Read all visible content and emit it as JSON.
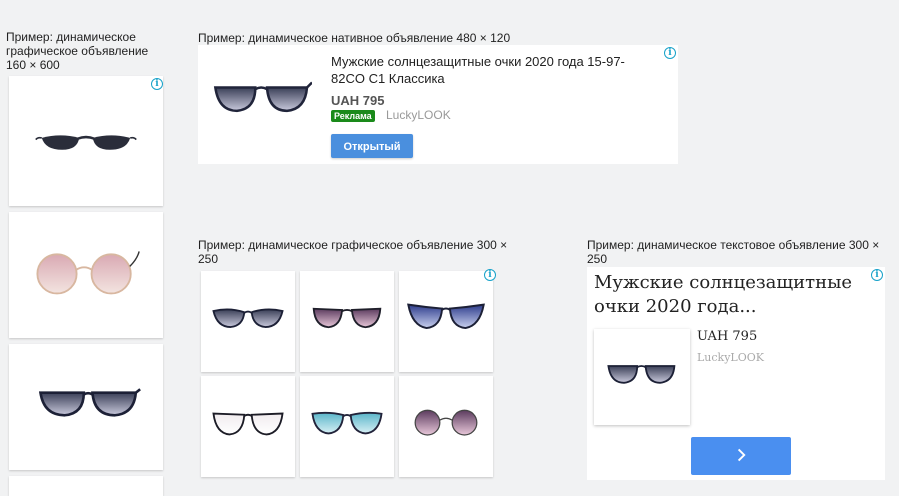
{
  "captions": {
    "vertical": "Пример: динамическое графическое объявление 160 × 600",
    "native": "Пример: динамическое нативное объявление 480 × 120",
    "medium": "Пример: динамическое графическое объявление 300 × 250",
    "text": "Пример: динамическое текстовое объявление 300 × 250"
  },
  "info_glyph": "i",
  "native_ad": {
    "title": "Мужские солнцезащитные очки 2020 года 15-97-82CO C1 Классика",
    "price": "UAH 795",
    "badge": "Реклама",
    "brand": "LuckyLOOK",
    "button": "Открытый"
  },
  "text_ad": {
    "title": "Мужские солнцезащитные очки 2020 года...",
    "price": "UAH 795",
    "brand": "LuckyLOOK",
    "button_icon": "chevron-right-icon"
  },
  "colors": {
    "accent_button": "#4a8fde",
    "badge_green": "#1a8a1a",
    "info_icon": "#17a2c9"
  }
}
